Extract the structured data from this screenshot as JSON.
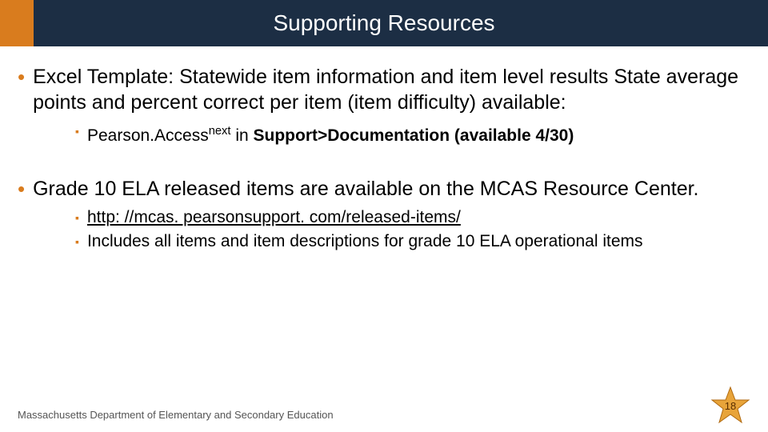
{
  "title": "Supporting Resources",
  "bullets": [
    {
      "text": "Excel Template: Statewide item information and item level results State average points and percent correct per item (item difficulty) available:",
      "subs": [
        {
          "prefix": "Pearson.Access",
          "sup": "next",
          "mid": " in ",
          "bold": "Support>Documentation (available 4/30)"
        }
      ]
    },
    {
      "text": "Grade 10 ELA released items are available on the MCAS Resource Center.",
      "subs": [
        {
          "link": "http: //mcas. pearsonsupport. com/released-items/"
        },
        {
          "plain": "Includes all items and item descriptions for grade 10 ELA operational items"
        }
      ]
    }
  ],
  "footer": "Massachusetts Department of Elementary and Secondary Education",
  "page_number": "18",
  "colors": {
    "accent": "#d97c1e",
    "header_bg": "#1c2e44"
  }
}
